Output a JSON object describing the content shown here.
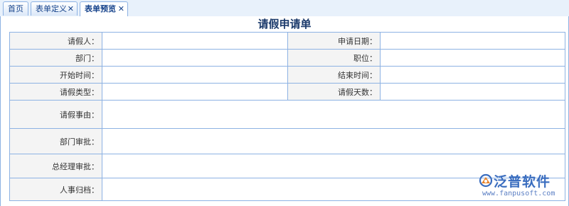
{
  "tabs": [
    {
      "label": "首页",
      "closable": false
    },
    {
      "label": "表单定义",
      "closable": true
    },
    {
      "label": "表单预览",
      "closable": true,
      "active": true
    }
  ],
  "close_glyph": "✕",
  "form": {
    "title": "请假申请单",
    "rows": [
      {
        "left_label": "请假人：",
        "right_label": "申请日期："
      },
      {
        "left_label": "部门：",
        "right_label": "职位："
      },
      {
        "left_label": "开始时间：",
        "right_label": "结束时间："
      },
      {
        "left_label": "请假类型：",
        "right_label": "请假天数："
      }
    ],
    "wide_rows": [
      {
        "label": "请假事由："
      },
      {
        "label": "部门审批："
      },
      {
        "label": "总经理审批："
      },
      {
        "label": "人事归档："
      }
    ]
  },
  "watermark": {
    "name": "泛普软件",
    "url": "www.fanpusoft.com",
    "logo_icon": "fanpu-logo-icon",
    "color": "#3a6dbf"
  }
}
